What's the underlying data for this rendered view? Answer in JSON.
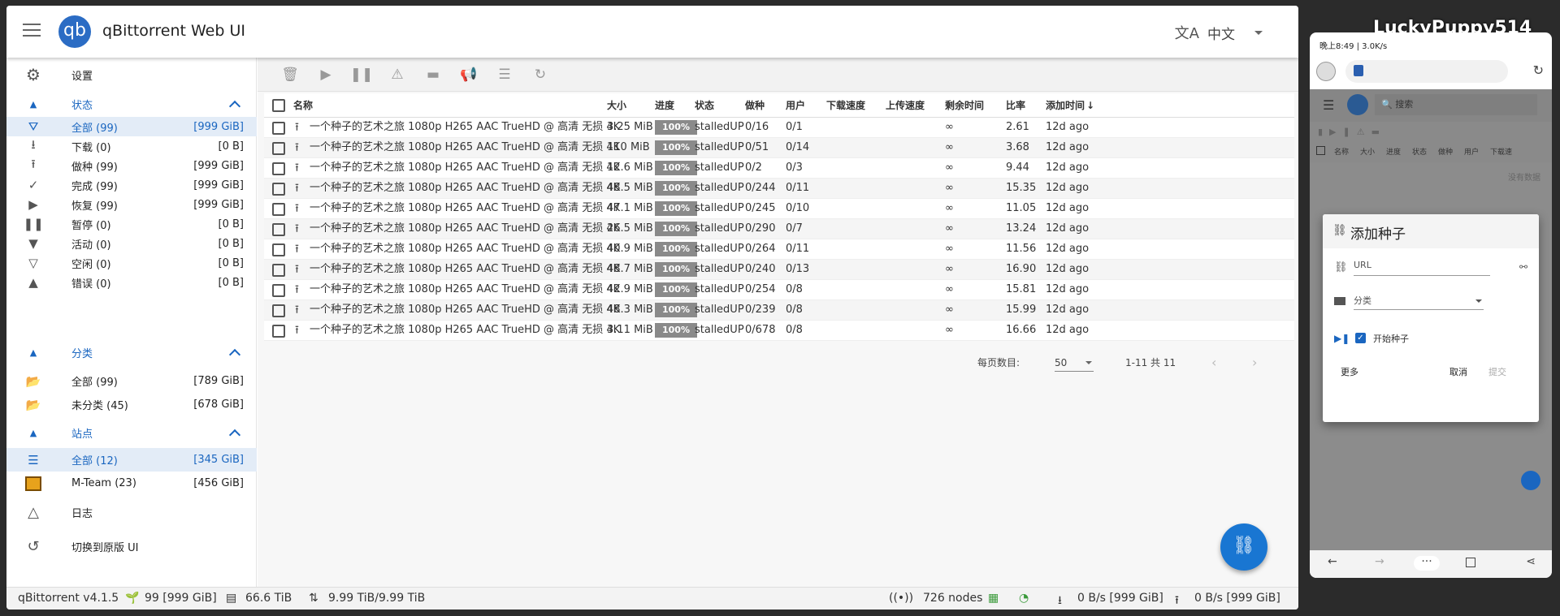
{
  "app": {
    "title": "qBittorrent Web UI",
    "logo": "qb",
    "lang": "中文"
  },
  "sidebar": {
    "settings": "设置",
    "status_header": "状态",
    "status": [
      {
        "label": "全部 (99)",
        "size": "[999 GiB]",
        "icon": "filter-all-icon"
      },
      {
        "label": "下载 (0)",
        "size": "[0 B]",
        "icon": "download-icon"
      },
      {
        "label": "做种 (99)",
        "size": "[999 GiB]",
        "icon": "upload-icon"
      },
      {
        "label": "完成 (99)",
        "size": "[999 GiB]",
        "icon": "check-icon"
      },
      {
        "label": "恢复 (99)",
        "size": "[999 GiB]",
        "icon": "play-icon"
      },
      {
        "label": "暂停 (0)",
        "size": "[0 B]",
        "icon": "pause-icon"
      },
      {
        "label": "活动 (0)",
        "size": "[0 B]",
        "icon": "filter-icon"
      },
      {
        "label": "空闲 (0)",
        "size": "[0 B]",
        "icon": "filter-outline-icon"
      },
      {
        "label": "错误 (0)",
        "size": "[0 B]",
        "icon": "warning-icon"
      }
    ],
    "category_header": "分类",
    "categories": [
      {
        "label": "全部 (99)",
        "size": "[789 GiB]"
      },
      {
        "label": "未分类 (45)",
        "size": "[678 GiB]"
      }
    ],
    "site_header": "站点",
    "sites": [
      {
        "label": "全部 (12)",
        "size": "[345 GiB]"
      },
      {
        "label": "M-Team (23)",
        "size": "[456 GiB]"
      }
    ],
    "log": "日志",
    "switch_ui": "切换到原版 UI"
  },
  "table": {
    "headers": {
      "name": "名称",
      "size": "大小",
      "progress": "进度",
      "state": "状态",
      "seeds": "做种",
      "peers": "用户",
      "dl": "下载速度",
      "ul": "上传速度",
      "eta": "剩余时间",
      "ratio": "比率",
      "added": "添加时间"
    },
    "rows": [
      {
        "name": "一个种子的艺术之旅 1080p H265 AAC TrueHD @ 高清 无损 4K",
        "size": "3.25 MiB",
        "progress": "100%",
        "state": "stalledUP",
        "seeds": "0/16",
        "peers": "0/1",
        "eta": "∞",
        "ratio": "2.61",
        "added": "12d ago"
      },
      {
        "name": "一个种子的艺术之旅 1080p H265 AAC TrueHD @ 高清 无损 4K",
        "size": "110 MiB",
        "progress": "100%",
        "state": "stalledUP",
        "seeds": "0/51",
        "peers": "0/14",
        "eta": "∞",
        "ratio": "3.68",
        "added": "12d ago"
      },
      {
        "name": "一个种子的艺术之旅 1080p H265 AAC TrueHD @ 高清 无损 4K",
        "size": "12.6 MiB",
        "progress": "100%",
        "state": "stalledUP",
        "seeds": "0/2",
        "peers": "0/3",
        "eta": "∞",
        "ratio": "9.44",
        "added": "12d ago"
      },
      {
        "name": "一个种子的艺术之旅 1080p H265 AAC TrueHD @ 高清 无损 4K",
        "size": "48.5 MiB",
        "progress": "100%",
        "state": "stalledUP",
        "seeds": "0/244",
        "peers": "0/11",
        "eta": "∞",
        "ratio": "15.35",
        "added": "12d ago"
      },
      {
        "name": "一个种子的艺术之旅 1080p H265 AAC TrueHD @ 高清 无损 4K",
        "size": "47.1 MiB",
        "progress": "100%",
        "state": "stalledUP",
        "seeds": "0/245",
        "peers": "0/10",
        "eta": "∞",
        "ratio": "11.05",
        "added": "12d ago"
      },
      {
        "name": "一个种子的艺术之旅 1080p H265 AAC TrueHD @ 高清 无损 4K",
        "size": "26.5 MiB",
        "progress": "100%",
        "state": "stalledUP",
        "seeds": "0/290",
        "peers": "0/7",
        "eta": "∞",
        "ratio": "13.24",
        "added": "12d ago"
      },
      {
        "name": "一个种子的艺术之旅 1080p H265 AAC TrueHD @ 高清 无损 4K",
        "size": "40.9 MiB",
        "progress": "100%",
        "state": "stalledUP",
        "seeds": "0/264",
        "peers": "0/11",
        "eta": "∞",
        "ratio": "11.56",
        "added": "12d ago"
      },
      {
        "name": "一个种子的艺术之旅 1080p H265 AAC TrueHD @ 高清 无损 4K",
        "size": "48.7 MiB",
        "progress": "100%",
        "state": "stalledUP",
        "seeds": "0/240",
        "peers": "0/13",
        "eta": "∞",
        "ratio": "16.90",
        "added": "12d ago"
      },
      {
        "name": "一个种子的艺术之旅 1080p H265 AAC TrueHD @ 高清 无损 4K",
        "size": "42.9 MiB",
        "progress": "100%",
        "state": "stalledUP",
        "seeds": "0/254",
        "peers": "0/8",
        "eta": "∞",
        "ratio": "15.81",
        "added": "12d ago"
      },
      {
        "name": "一个种子的艺术之旅 1080p H265 AAC TrueHD @ 高清 无损 4K",
        "size": "48.3 MiB",
        "progress": "100%",
        "state": "stalledUP",
        "seeds": "0/239",
        "peers": "0/8",
        "eta": "∞",
        "ratio": "15.99",
        "added": "12d ago"
      },
      {
        "name": "一个种子的艺术之旅 1080p H265 AAC TrueHD @ 高清 无损 4K",
        "size": "3.11 MiB",
        "progress": "100%",
        "state": "stalledUP",
        "seeds": "0/678",
        "peers": "0/8",
        "eta": "∞",
        "ratio": "16.66",
        "added": "12d ago"
      }
    ]
  },
  "pager": {
    "per_page_label": "每页数目:",
    "per_page": "50",
    "range": "1-11 共 11"
  },
  "statusbar": {
    "version": "qBittorrent v4.1.5",
    "torrents": "99 [999 GiB]",
    "free": "66.6 TiB",
    "alltime": "9.99 TiB/9.99 TiB",
    "nodes": "726 nodes",
    "dl": "0 B/s [999 GiB]",
    "ul": "0 B/s [999 GiB]"
  },
  "phone": {
    "watermark": "LuckyPuppy514",
    "status_time": "晚上8:49 | 3.0K/s",
    "search_placeholder": "搜索",
    "cols": [
      "名称",
      "大小",
      "进度",
      "状态",
      "做种",
      "用户",
      "下载速"
    ],
    "no_data": "没有数据",
    "dialog": {
      "title": "添加种子",
      "url_placeholder": "URL",
      "category": "分类",
      "start": "开始种子",
      "more": "更多",
      "cancel": "取消",
      "submit": "提交"
    }
  }
}
